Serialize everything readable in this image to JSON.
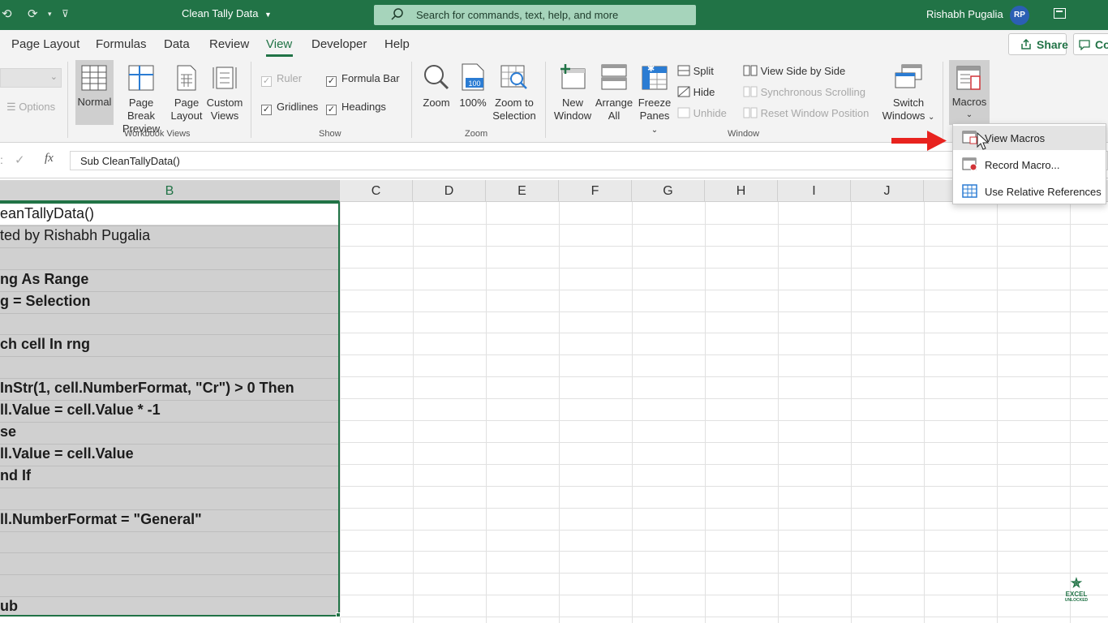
{
  "title_bar": {
    "doc_title": "Clean Tally Data",
    "search_placeholder": "Search for commands, text, help, and more",
    "user_name": "Rishabh Pugalia",
    "avatar_initials": "RP"
  },
  "tabs": {
    "items": [
      "Page Layout",
      "Formulas",
      "Data",
      "Review",
      "View",
      "Developer",
      "Help"
    ],
    "active": "View",
    "share_label": "Share",
    "comments_label": "Co"
  },
  "ribbon": {
    "options_label": "Options",
    "workbook_views": {
      "group_label": "Workbook Views",
      "normal": "Normal",
      "page_break": [
        "Page Break",
        "Preview"
      ],
      "page_layout": [
        "Page",
        "Layout"
      ],
      "custom_views": [
        "Custom",
        "Views"
      ]
    },
    "show": {
      "group_label": "Show",
      "ruler": "Ruler",
      "formula_bar": "Formula Bar",
      "gridlines": "Gridlines",
      "headings": "Headings"
    },
    "zoom": {
      "group_label": "Zoom",
      "zoom": "Zoom",
      "hundred": "100%",
      "zoom_to_selection": [
        "Zoom to",
        "Selection"
      ]
    },
    "window": {
      "group_label": "Window",
      "new_window": [
        "New",
        "Window"
      ],
      "arrange_all": [
        "Arrange",
        "All"
      ],
      "freeze_panes": [
        "Freeze",
        "Panes"
      ],
      "split": "Split",
      "hide": "Hide",
      "unhide": "Unhide",
      "view_side_by_side": "View Side by Side",
      "synchronous_scrolling": "Synchronous Scrolling",
      "reset_window_position": "Reset Window Position",
      "switch_windows": [
        "Switch",
        "Windows"
      ]
    },
    "macros": {
      "label": "Macros"
    }
  },
  "formula_bar": {
    "fx": "fx",
    "content": "Sub CleanTallyData()"
  },
  "columns": [
    "B",
    "C",
    "D",
    "E",
    "F",
    "G",
    "H",
    "I",
    "J"
  ],
  "selected_column": "B",
  "cells_b": [
    "eanTallyData()",
    "ted by Rishabh Pugalia",
    "",
    "ng As Range",
    "g = Selection",
    "",
    "ch cell In rng",
    "",
    "InStr(1, cell.NumberFormat, \"Cr\") > 0 Then",
    "ll.Value = cell.Value * -1",
    "se",
    "ll.Value = cell.Value",
    "nd If",
    "",
    "ll.NumberFormat = \"General\"",
    "",
    "",
    "",
    "ub"
  ],
  "macro_menu": {
    "items": [
      "View Macros",
      "Record Macro...",
      "Use Relative References"
    ],
    "hovered": "View Macros"
  },
  "logo": {
    "line1": "EXCEL",
    "line2": "UNLOCKED"
  },
  "colors": {
    "brand_green": "#217346",
    "arrow_red": "#e8231f"
  }
}
